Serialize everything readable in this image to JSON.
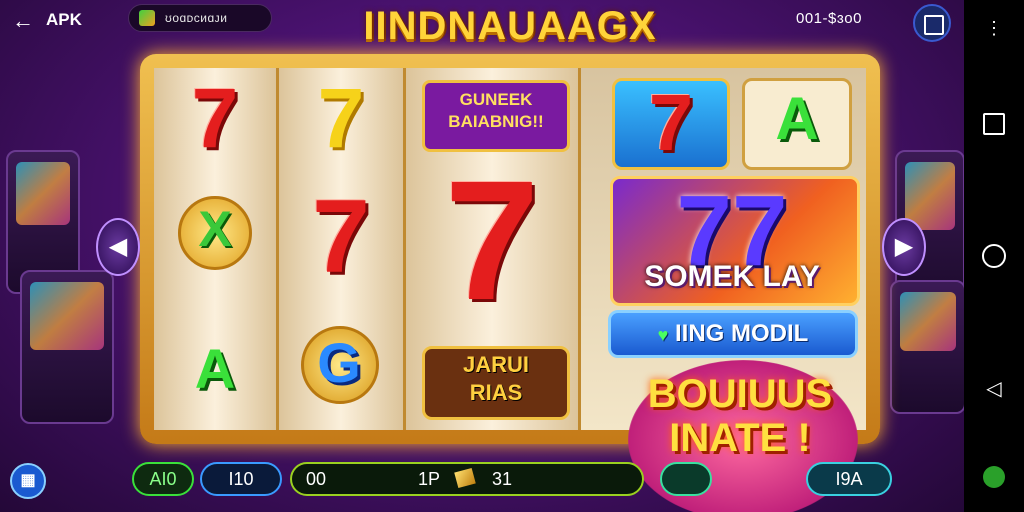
{
  "topbar": {
    "back_label": "APK",
    "account_text": "ʊᴏɑᴅᴄᴎɑᴊᴎ",
    "game_title": "IINDNAUAAGX",
    "score": "001-$ɜo0"
  },
  "reels": {
    "reel1": [
      "7",
      "X",
      "A"
    ],
    "reel2": [
      "7",
      "7",
      "G"
    ],
    "reel3_banner": [
      "GUNEEK",
      "BAIABNIG!!"
    ],
    "reel3_big": "7",
    "reel3_badge": [
      "JARUI",
      "RIAS"
    ],
    "reel4_top_left": "7",
    "reel4_top_right": "A",
    "reel4_panel_sevens": "77"
  },
  "panel": {
    "play_label": "SOMEK LAY",
    "mode_button": "IING MODIL",
    "mode_icon": "heart-icon",
    "bonus_lines": [
      "BOUIUUS",
      "INATE !"
    ]
  },
  "bottom": {
    "btn1": "AI0",
    "btn2": "I10",
    "bet_left": "00",
    "bet_mid": "1P",
    "bet_right": "31",
    "btn_right": "I9A"
  },
  "colors": {
    "accent_gold": "#ffd43a",
    "seven_red": "#e41e1e",
    "panel_blue": "#1a5ad0",
    "bonus_pink": "#c0207a"
  }
}
